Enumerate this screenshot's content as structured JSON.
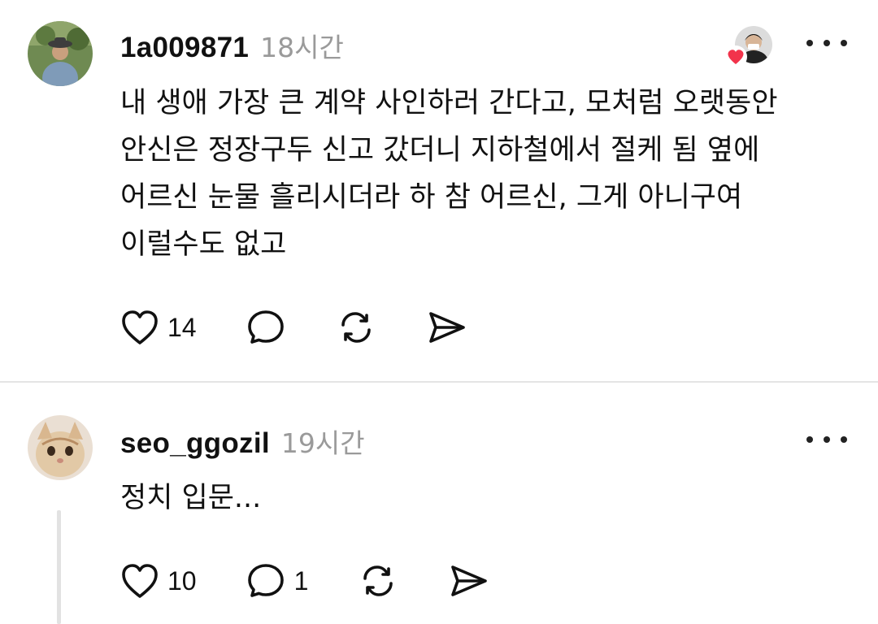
{
  "posts": [
    {
      "username": "1a009871",
      "time": "18시간",
      "text": "내 생애 가장 큰 계약 사인하러 간다고, 모처럼 오랫동안\n안신은 정장구두 신고 갔더니 지하철에서 절케 됨 옆에\n어르신 눈물 흘리시더라 하 참 어르신, 그게 아니구여\n이럴수도 없고",
      "likes": "14",
      "replies": "",
      "liked_by_avatar": "liker-avatar-with-heart",
      "colors": {
        "heart_badge": "#f2334b"
      }
    },
    {
      "username": "seo_ggozil",
      "time": "19시간",
      "text": "정치 입문...",
      "likes": "10",
      "replies": "1"
    }
  ],
  "icons": {
    "like": "heart-outline-icon",
    "reply": "speech-bubble-icon",
    "repost": "repost-arrows-icon",
    "share": "paper-plane-icon",
    "more": "more-horizontal-icon"
  }
}
